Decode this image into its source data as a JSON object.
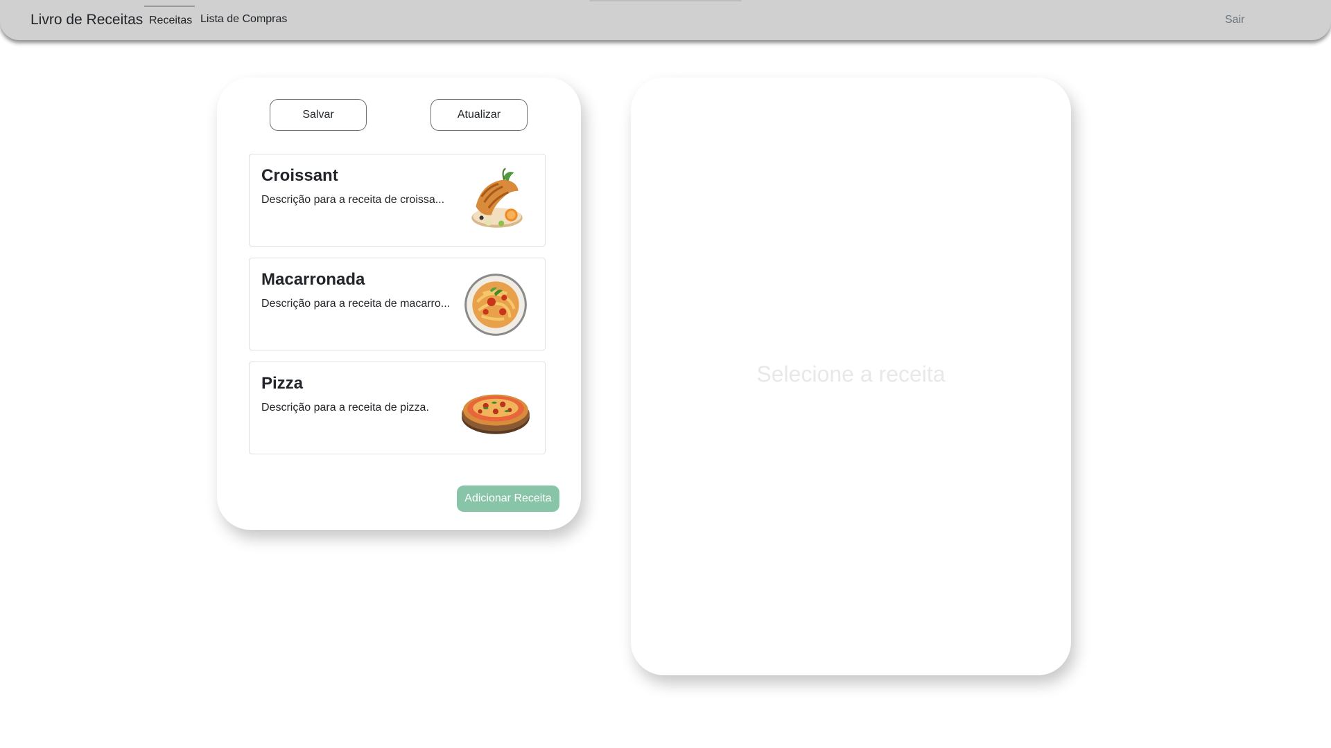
{
  "navbar": {
    "brand": "Livro de Receitas",
    "links": [
      {
        "label": "Receitas",
        "active": true
      },
      {
        "label": "Lista de Compras",
        "active": false
      }
    ],
    "logout_label": "Sair"
  },
  "recipes_panel": {
    "save_label": "Salvar",
    "update_label": "Atualizar",
    "recipes": [
      {
        "name": "Croissant",
        "description": "Descrição para a receita de croissa...",
        "image": "croissant-image"
      },
      {
        "name": "Macarronada",
        "description": "Descrição para a receita de macarro...",
        "image": "pasta-plate-image"
      },
      {
        "name": "Pizza",
        "description": "Descrição para a receita de pizza.",
        "image": "pizza-image"
      }
    ],
    "add_label": "Adicionar Receita"
  },
  "detail_panel": {
    "placeholder": "Selecione a receita"
  },
  "colors": {
    "navbar_bg": "#d0d0d0",
    "add_button": "#88c4a8",
    "placeholder_text": "#e8e8e8"
  }
}
